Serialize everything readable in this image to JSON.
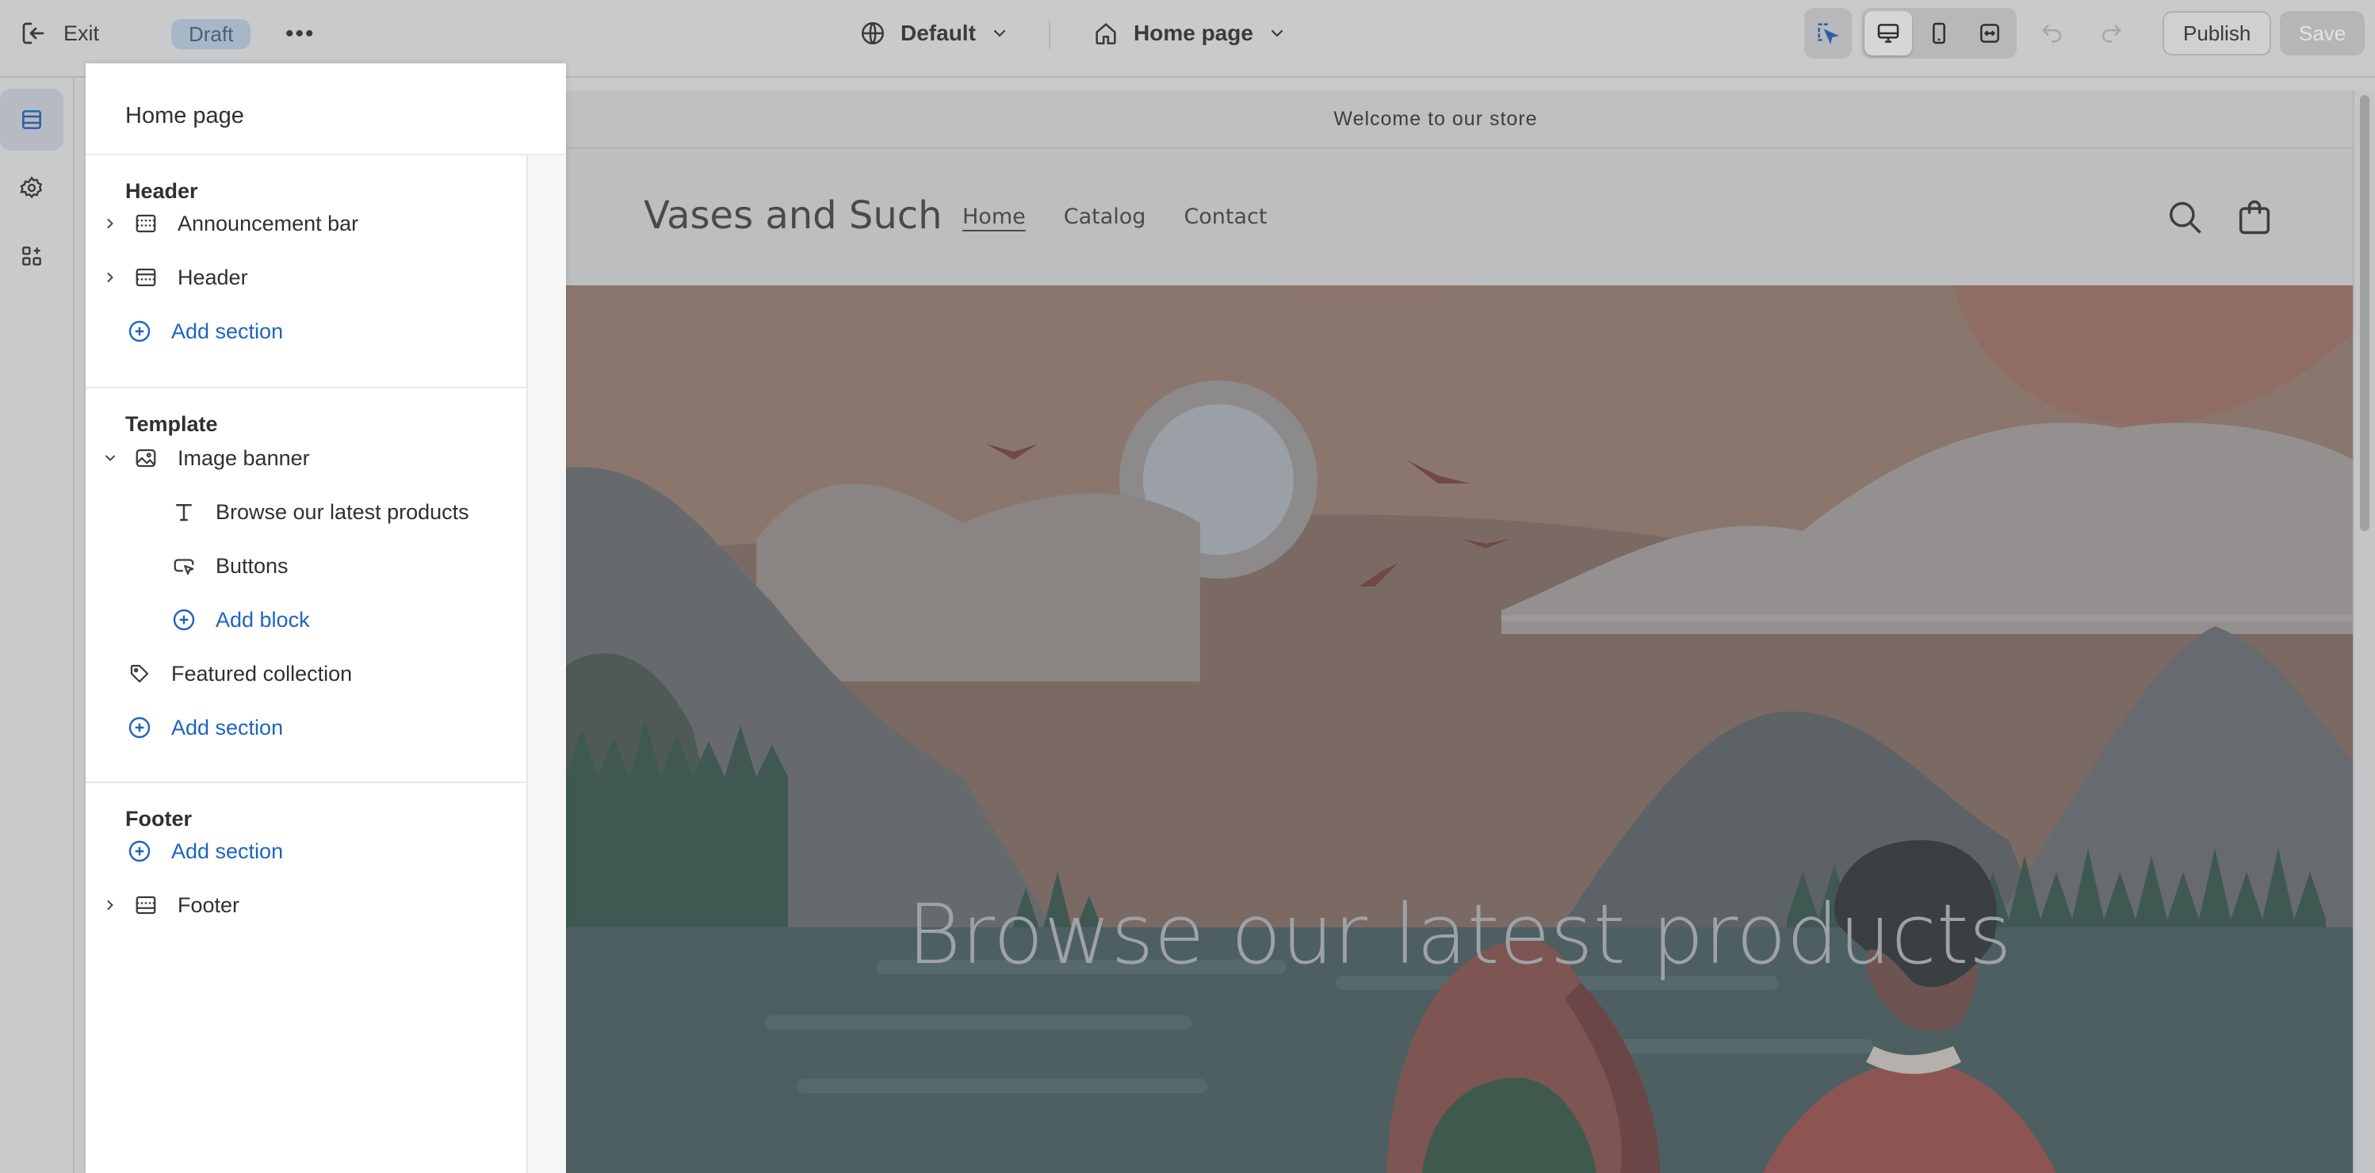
{
  "topbar": {
    "exit_label": "Exit",
    "status_badge": "Draft",
    "more_label": "•••",
    "theme_selector": "Default",
    "page_selector": "Home page",
    "publish_label": "Publish",
    "save_label": "Save",
    "icons": [
      "exit-icon",
      "globe-icon",
      "home-icon",
      "inspector-icon",
      "desktop-icon",
      "mobile-icon",
      "fullwidth-icon",
      "undo-icon",
      "redo-icon"
    ]
  },
  "rail": {
    "items": [
      "sections-icon",
      "settings-icon",
      "apps-icon"
    ]
  },
  "panel": {
    "title": "Home page",
    "groups": {
      "header": {
        "title": "Header",
        "items": [
          "Announcement bar",
          "Header"
        ],
        "add_label": "Add section"
      },
      "template": {
        "title": "Template",
        "banner_label": "Image banner",
        "blocks": [
          "Browse our latest products",
          "Buttons"
        ],
        "add_block_label": "Add block",
        "featured_label": "Featured collection",
        "add_label": "Add section"
      },
      "footer": {
        "title": "Footer",
        "add_label": "Add section",
        "items": [
          "Footer"
        ]
      }
    }
  },
  "preview": {
    "announcement": "Welcome to our store",
    "store_name": "Vases and Such",
    "nav": [
      "Home",
      "Catalog",
      "Contact"
    ],
    "banner_heading": "Browse our latest products"
  },
  "colors": {
    "accent": "#1d64c0",
    "panel_bg": "#ffffff",
    "overlay_bg": "#c9cacc"
  }
}
